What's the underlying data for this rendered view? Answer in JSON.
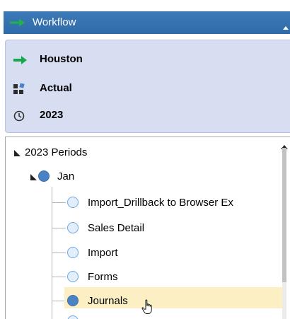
{
  "workflow": {
    "title": "Workflow",
    "colors": {
      "header": "#2f6aa9",
      "arrow": "#22b14c"
    }
  },
  "pov": {
    "entity": {
      "label": "Houston",
      "icon": "green-arrow-icon"
    },
    "scenario": {
      "label": "Actual",
      "icon": "scenario-blocks-icon"
    },
    "time": {
      "label": "2023",
      "icon": "clock-icon"
    }
  },
  "tree": {
    "root": {
      "label": "2023 Periods",
      "expanded": true
    },
    "period": {
      "label": "Jan",
      "expanded": true
    },
    "steps": [
      {
        "label": "Import_Drillback to Browser Ex",
        "status": "empty"
      },
      {
        "label": "Sales Detail",
        "status": "empty"
      },
      {
        "label": "Import",
        "status": "empty"
      },
      {
        "label": "Forms",
        "status": "empty"
      },
      {
        "label": "Journals",
        "status": "filled",
        "selected": true
      }
    ]
  }
}
